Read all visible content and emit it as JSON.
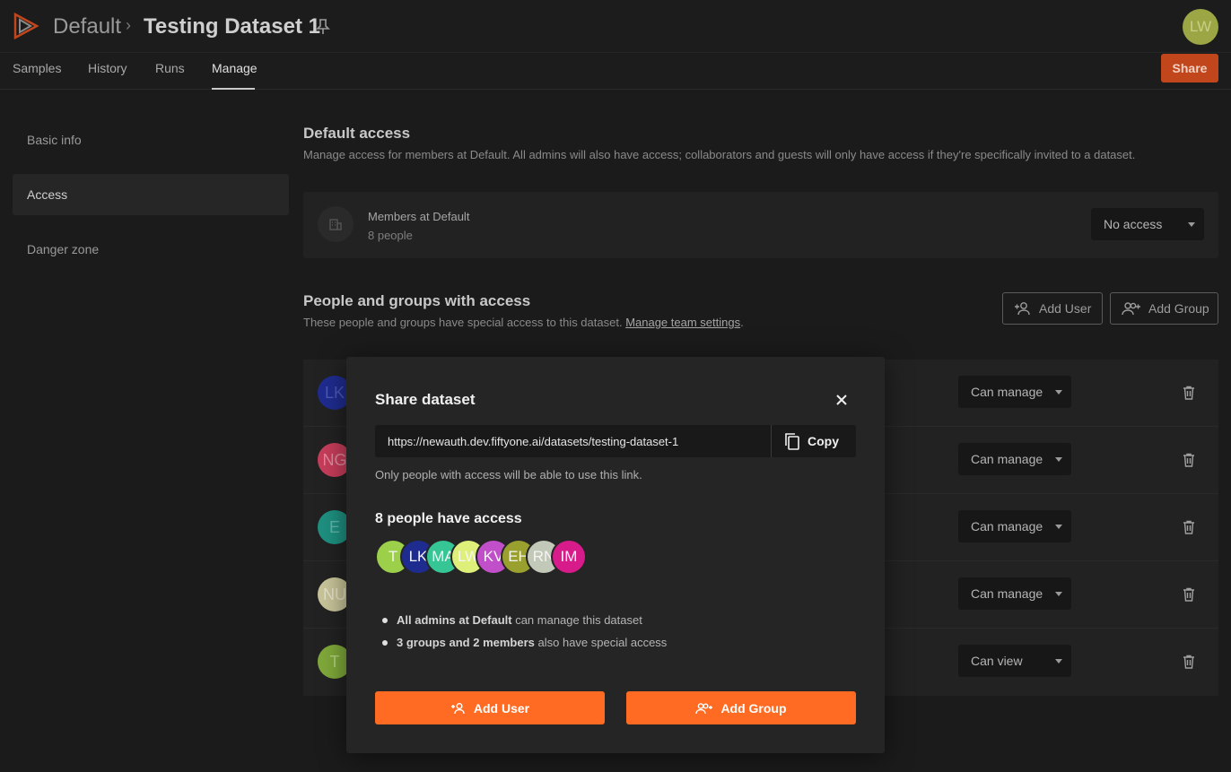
{
  "header": {
    "org": "Default",
    "dataset": "Testing Dataset 1",
    "user_initials": "LW",
    "share_label": "Share",
    "tabs": [
      {
        "label": "Samples"
      },
      {
        "label": "History"
      },
      {
        "label": "Runs"
      },
      {
        "label": "Manage"
      }
    ],
    "active_tab": "Manage"
  },
  "sidebar": {
    "items": [
      {
        "label": "Basic info"
      },
      {
        "label": "Access"
      },
      {
        "label": "Danger zone"
      }
    ],
    "active": "Access"
  },
  "default_access": {
    "title": "Default access",
    "description": "Manage access for members at Default. All admins will also have access; collaborators and guests will only have access if they're specifically invited to a dataset.",
    "members_title": "Members at Default",
    "members_count": "8 people",
    "access_value": "No access"
  },
  "people_section": {
    "title": "People and groups with access",
    "description": "These people and groups have special access to this dataset.",
    "link_text": "Manage team settings",
    "link_suffix": ".",
    "add_user_label": "Add User",
    "add_group_label": "Add Group",
    "rows": [
      {
        "initials": "LK",
        "color": "#1f2c8f",
        "permission": "Can manage"
      },
      {
        "initials": "NG",
        "color": "#c63d5a",
        "permission": "Can manage"
      },
      {
        "initials": "E",
        "color": "#1e9080",
        "permission": "Can manage"
      },
      {
        "initials": "NU",
        "color": "#c8c49a",
        "permission": "Can manage"
      },
      {
        "initials": "T",
        "color": "#7fa83a",
        "permission": "Can view"
      }
    ]
  },
  "modal": {
    "title": "Share dataset",
    "url": "https://newauth.dev.fiftyone.ai/datasets/testing-dataset-1",
    "copy_label": "Copy",
    "url_note": "Only people with access will be able to use this link.",
    "access_title": "8 people have access",
    "avatars": [
      {
        "initials": "T",
        "color": "#9ccf4a"
      },
      {
        "initials": "LK",
        "color": "#1f2c8f"
      },
      {
        "initials": "MA",
        "color": "#36c595"
      },
      {
        "initials": "LW",
        "color": "#dff07a"
      },
      {
        "initials": "KV",
        "color": "#c14fc9"
      },
      {
        "initials": "EH",
        "color": "#9aa02e"
      },
      {
        "initials": "RN",
        "color": "#c3c9b9"
      },
      {
        "initials": "IM",
        "color": "#d81b8a"
      }
    ],
    "bullet1_bold": "All admins at Default",
    "bullet1_rest": " can manage this dataset",
    "bullet2_bold": "3 groups and 2 members",
    "bullet2_rest": " also have special access",
    "add_user_label": "Add User",
    "add_group_label": "Add Group"
  },
  "colors": {
    "accent": "#ff6b22",
    "share_button": "#c1461c"
  }
}
